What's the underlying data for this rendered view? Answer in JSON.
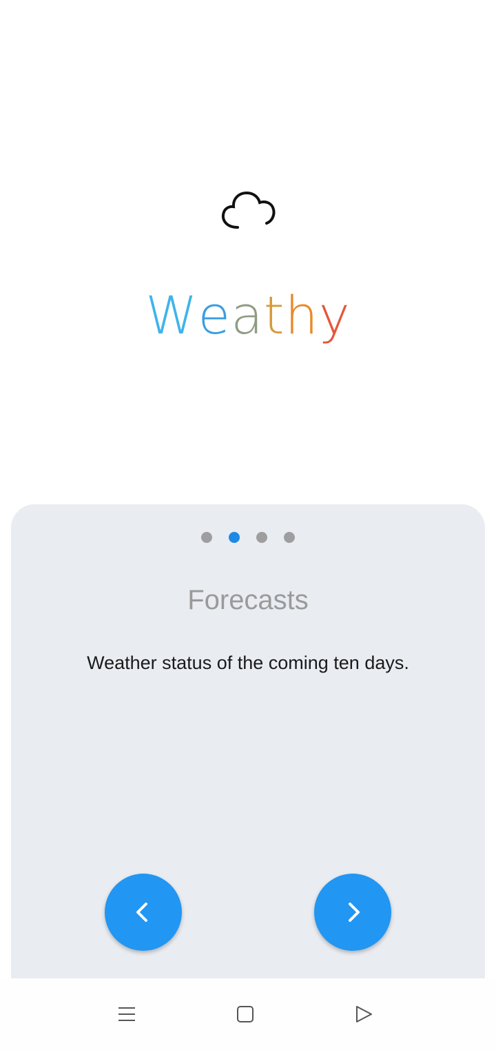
{
  "app": {
    "title": "Weathy",
    "title_letters": [
      {
        "char": "W",
        "color": "#3fb4ea"
      },
      {
        "char": "e",
        "color": "#3a9de0"
      },
      {
        "char": "a",
        "color": "#8f9c84"
      },
      {
        "char": "t",
        "color": "#d69a3b"
      },
      {
        "char": "h",
        "color": "#e88a2a"
      },
      {
        "char": "y",
        "color": "#e5563a"
      }
    ],
    "logo_icon": "cloud-icon"
  },
  "onboarding": {
    "page_indicator": {
      "total": 4,
      "active_index": 1
    },
    "slide_title": "Forecasts",
    "slide_description": "Weather status of the coming ten days.",
    "prev_icon": "chevron-left-icon",
    "next_icon": "chevron-right-icon",
    "accent_color": "#2196f3",
    "card_color": "#e9ecf1"
  },
  "system_nav": {
    "menu_icon": "menu-icon",
    "home_icon": "home-square-icon",
    "back_icon": "back-triangle-icon"
  }
}
